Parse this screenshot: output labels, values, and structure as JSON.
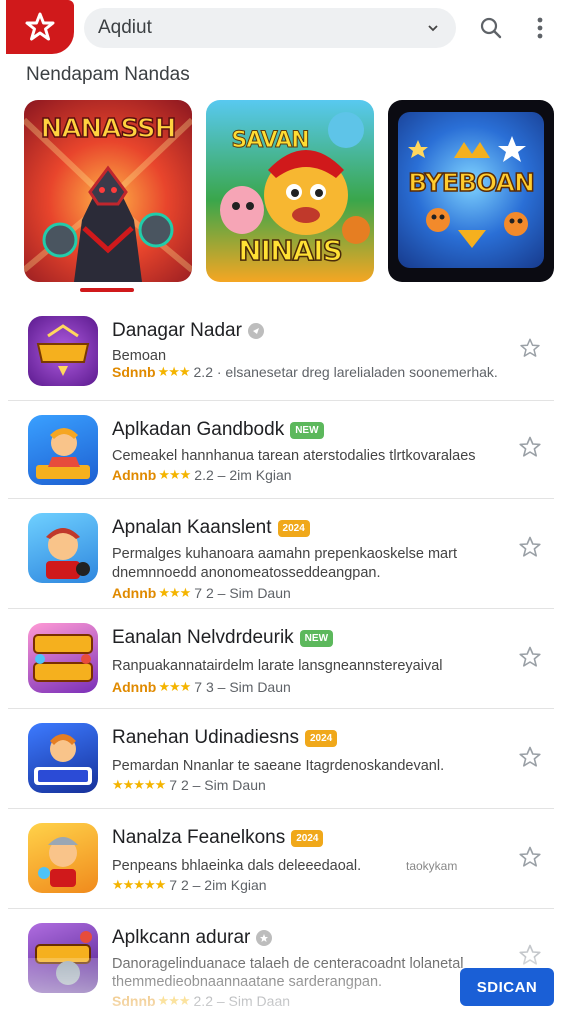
{
  "header": {
    "search_value": "Aqdiut",
    "icons": [
      "app-logo-icon",
      "chevron-down-icon",
      "search-icon",
      "more-vert-icon"
    ]
  },
  "section": {
    "title": "Nendapam Nandas"
  },
  "featured": [
    {
      "label": "NANASSH",
      "icon": "featured-game-banner"
    },
    {
      "label_top": "SAVAN",
      "label_bottom": "NINAIS",
      "icon": "featured-game-banner"
    },
    {
      "label": "BYEBOAN",
      "icon": "featured-game-banner"
    }
  ],
  "apps": [
    {
      "title": "Danagar Nadar",
      "badge": "",
      "badge_type": "gray",
      "desc_line1": "Bemoan",
      "rating_lead": "Sdnnb",
      "meta": "2.2 · elsanesetar dreg larelialaden soonemerhak."
    },
    {
      "title": "Aplkadan Gandbodk",
      "badge": "NEW",
      "badge_type": "green",
      "desc_line1": "Cemeakel hannhanua tarean aterstodalies tlrtkovaralaes",
      "rating_lead": "Adnnb",
      "meta": "2.2 – 2im Kgian"
    },
    {
      "title": "Apnalan Kaanslent",
      "badge": "2024",
      "badge_type": "orange",
      "desc_line1": "Permalges kuhanoara aamahn prepenkaoskelse mart",
      "desc_line2": "dnemnnoedd anonomeatosseddeangpan.",
      "rating_lead": "Adnnb",
      "meta": "7 2 – Sim Daun"
    },
    {
      "title": "Eanalan Nelvdrdeurik",
      "badge": "NEW",
      "badge_type": "green",
      "desc_line1": "Ranpuakannatairdelm larate lansgneannstereyaival",
      "rating_lead": "Adnnb",
      "meta": "7 3 – Sim Daun"
    },
    {
      "title": "Ranehan Udinadiesns",
      "badge": "2024",
      "badge_type": "orange",
      "desc_line1": "Pemardan Nnanlar te saeane Itagrdenoskandevanl.",
      "rating_lead": "",
      "meta": "7 2 – Sim Daun"
    },
    {
      "title": "Nanalza Feanelkons",
      "badge": "2024",
      "badge_type": "orange",
      "desc_line1": "Penpeans bhlaeinka dals deleeedaoal.",
      "desc_extra": "taokykam",
      "rating_lead": "",
      "meta": "7 2 – 2im Kgian"
    },
    {
      "title": "Aplkcann adurar",
      "badge": "",
      "badge_type": "gray",
      "desc_line1": "Danoragelinduanace talaeh de centeracoadnt lolanetal",
      "desc_line2": "themmedieobnaannaatane sarderangpan.",
      "rating_lead": "Sdnnb",
      "meta": "2.2 – Sim Daan"
    }
  ],
  "cta": {
    "label": "SDICAN"
  },
  "colors": {
    "brand_red": "#d0191b",
    "accent_blue": "#1a5fd6",
    "star_yellow": "#f4b400"
  }
}
